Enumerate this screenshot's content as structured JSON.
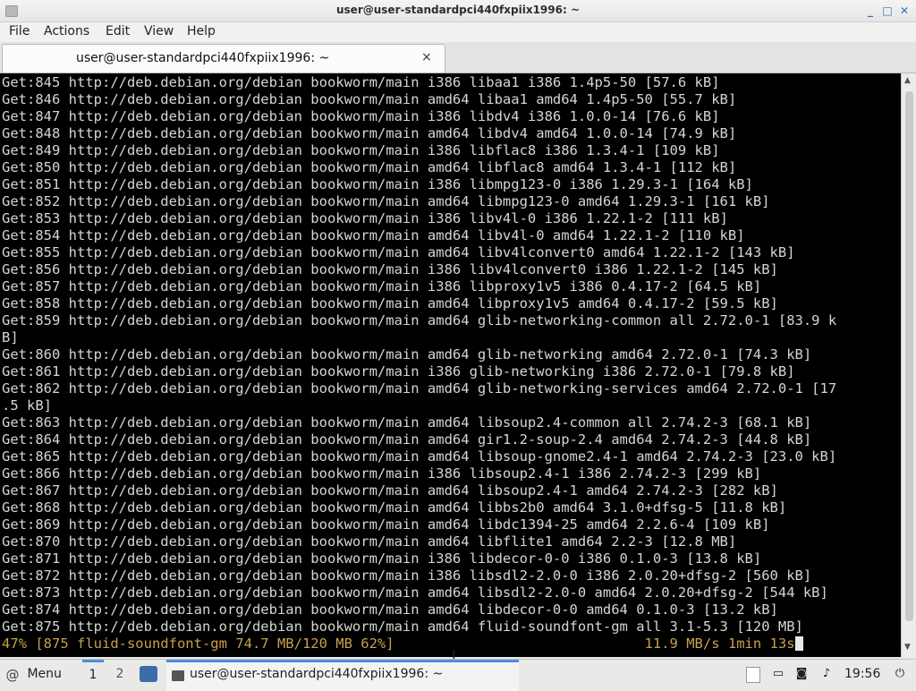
{
  "window": {
    "title": "user@user-standardpci440fxpiix1996: ~",
    "controls": {
      "minimize": "_",
      "maximize": "□",
      "close": "✕"
    }
  },
  "menu": [
    "File",
    "Actions",
    "Edit",
    "View",
    "Help"
  ],
  "tab": {
    "label": "user@user-standardpci440fxpiix1996: ~",
    "close": "×"
  },
  "terminal": {
    "lines": [
      "Get:845 http://deb.debian.org/debian bookworm/main i386 libaa1 i386 1.4p5-50 [57.6 kB]",
      "Get:846 http://deb.debian.org/debian bookworm/main amd64 libaa1 amd64 1.4p5-50 [55.7 kB]",
      "Get:847 http://deb.debian.org/debian bookworm/main i386 libdv4 i386 1.0.0-14 [76.6 kB]",
      "Get:848 http://deb.debian.org/debian bookworm/main amd64 libdv4 amd64 1.0.0-14 [74.9 kB]",
      "Get:849 http://deb.debian.org/debian bookworm/main i386 libflac8 i386 1.3.4-1 [109 kB]",
      "Get:850 http://deb.debian.org/debian bookworm/main amd64 libflac8 amd64 1.3.4-1 [112 kB]",
      "Get:851 http://deb.debian.org/debian bookworm/main i386 libmpg123-0 i386 1.29.3-1 [164 kB]",
      "Get:852 http://deb.debian.org/debian bookworm/main amd64 libmpg123-0 amd64 1.29.3-1 [161 kB]",
      "Get:853 http://deb.debian.org/debian bookworm/main i386 libv4l-0 i386 1.22.1-2 [111 kB]",
      "Get:854 http://deb.debian.org/debian bookworm/main amd64 libv4l-0 amd64 1.22.1-2 [110 kB]",
      "Get:855 http://deb.debian.org/debian bookworm/main amd64 libv4lconvert0 amd64 1.22.1-2 [143 kB]",
      "Get:856 http://deb.debian.org/debian bookworm/main i386 libv4lconvert0 i386 1.22.1-2 [145 kB]",
      "Get:857 http://deb.debian.org/debian bookworm/main i386 libproxy1v5 i386 0.4.17-2 [64.5 kB]",
      "Get:858 http://deb.debian.org/debian bookworm/main amd64 libproxy1v5 amd64 0.4.17-2 [59.5 kB]",
      "Get:859 http://deb.debian.org/debian bookworm/main amd64 glib-networking-common all 2.72.0-1 [83.9 k",
      "B]",
      "Get:860 http://deb.debian.org/debian bookworm/main amd64 glib-networking amd64 2.72.0-1 [74.3 kB]",
      "Get:861 http://deb.debian.org/debian bookworm/main i386 glib-networking i386 2.72.0-1 [79.8 kB]",
      "Get:862 http://deb.debian.org/debian bookworm/main amd64 glib-networking-services amd64 2.72.0-1 [17",
      ".5 kB]",
      "Get:863 http://deb.debian.org/debian bookworm/main amd64 libsoup2.4-common all 2.74.2-3 [68.1 kB]",
      "Get:864 http://deb.debian.org/debian bookworm/main amd64 gir1.2-soup-2.4 amd64 2.74.2-3 [44.8 kB]",
      "Get:865 http://deb.debian.org/debian bookworm/main amd64 libsoup-gnome2.4-1 amd64 2.74.2-3 [23.0 kB]",
      "Get:866 http://deb.debian.org/debian bookworm/main i386 libsoup2.4-1 i386 2.74.2-3 [299 kB]",
      "Get:867 http://deb.debian.org/debian bookworm/main amd64 libsoup2.4-1 amd64 2.74.2-3 [282 kB]",
      "Get:868 http://deb.debian.org/debian bookworm/main amd64 libbs2b0 amd64 3.1.0+dfsg-5 [11.8 kB]",
      "Get:869 http://deb.debian.org/debian bookworm/main amd64 libdc1394-25 amd64 2.2.6-4 [109 kB]",
      "Get:870 http://deb.debian.org/debian bookworm/main amd64 libflite1 amd64 2.2-3 [12.8 MB]",
      "Get:871 http://deb.debian.org/debian bookworm/main i386 libdecor-0-0 i386 0.1.0-3 [13.8 kB]",
      "Get:872 http://deb.debian.org/debian bookworm/main i386 libsdl2-2.0-0 i386 2.0.20+dfsg-2 [560 kB]",
      "Get:873 http://deb.debian.org/debian bookworm/main amd64 libsdl2-2.0-0 amd64 2.0.20+dfsg-2 [544 kB]",
      "Get:874 http://deb.debian.org/debian bookworm/main amd64 libdecor-0-0 amd64 0.1.0-3 [13.2 kB]",
      "Get:875 http://deb.debian.org/debian bookworm/main amd64 fluid-soundfont-gm all 3.1-5.3 [120 MB]"
    ],
    "progress_line": "47% [875 fluid-soundfont-gm 74.7 MB/120 MB 62%]                              11.9 MB/s 1min 13s",
    "text_color": "#d3d7cf",
    "progress_color": "#c8a04a",
    "background": "#000000"
  },
  "taskbar": {
    "menu_label": "Menu",
    "menu_icon": "debian-swirl-icon",
    "workspaces": [
      "1",
      "2"
    ],
    "active_task_label": "user@user-standardpci440fxpiix1996: ~",
    "clock": "19:56",
    "accent": "#4a90d9"
  }
}
